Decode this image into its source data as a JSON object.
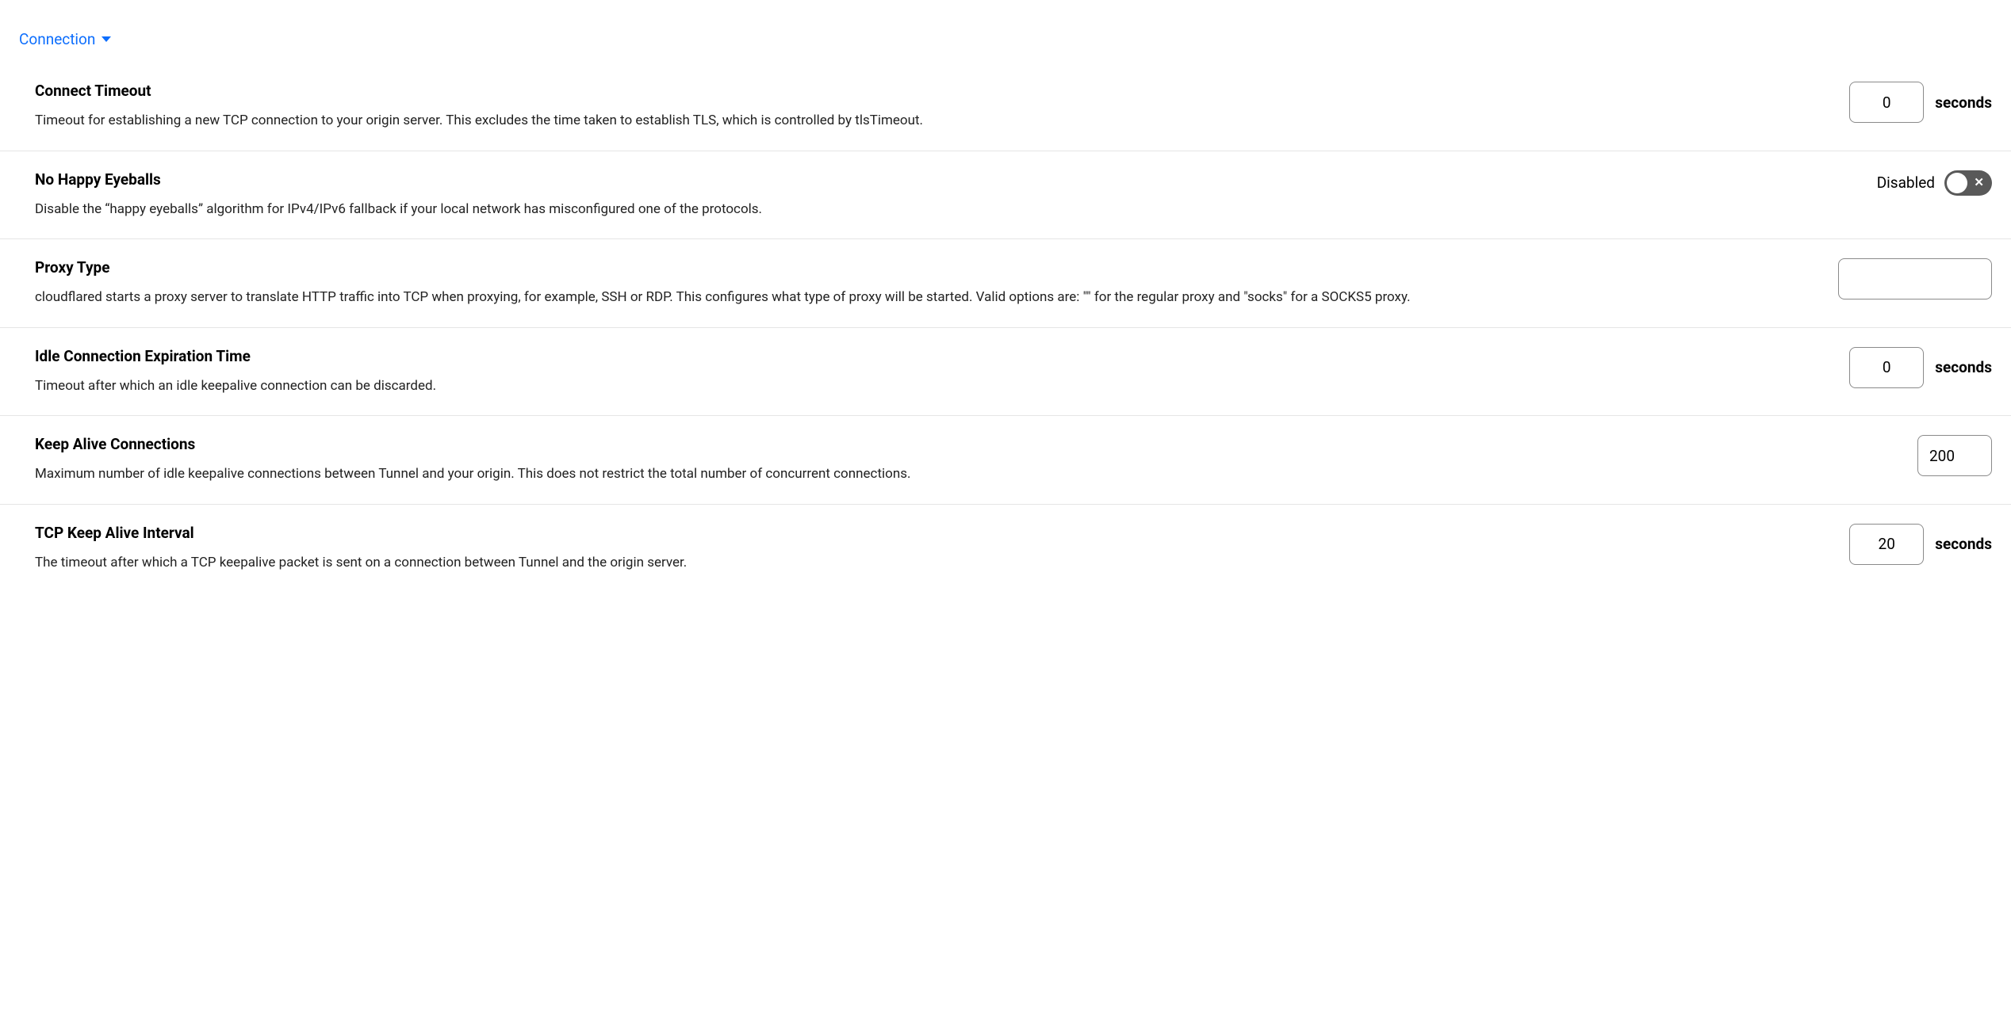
{
  "section": {
    "title": "Connection"
  },
  "settings": {
    "connectTimeout": {
      "title": "Connect Timeout",
      "desc": "Timeout for establishing a new TCP connection to your origin server. This excludes the time taken to establish TLS, which is controlled by tlsTimeout.",
      "value": "0",
      "unit": "seconds"
    },
    "noHappyEyeballs": {
      "title": "No Happy Eyeballs",
      "desc": "Disable the “happy eyeballs” algorithm for IPv4/IPv6 fallback if your local network has misconfigured one of the protocols.",
      "stateLabel": "Disabled",
      "enabled": false
    },
    "proxyType": {
      "title": "Proxy Type",
      "desc": "cloudflared starts a proxy server to translate HTTP traffic into TCP when proxying, for example, SSH or RDP. This configures what type of proxy will be started. Valid options are: \"\" for the regular proxy and \"socks\" for a SOCKS5 proxy.",
      "value": ""
    },
    "idleConnExpiration": {
      "title": "Idle Connection Expiration Time",
      "desc": "Timeout after which an idle keepalive connection can be discarded.",
      "value": "0",
      "unit": "seconds"
    },
    "keepAliveConnections": {
      "title": "Keep Alive Connections",
      "desc": "Maximum number of idle keepalive connections between Tunnel and your origin. This does not restrict the total number of concurrent connections.",
      "value": "200"
    },
    "tcpKeepAliveInterval": {
      "title": "TCP Keep Alive Interval",
      "desc": "The timeout after which a TCP keepalive packet is sent on a connection between Tunnel and the origin server.",
      "value": "20",
      "unit": "seconds"
    }
  }
}
